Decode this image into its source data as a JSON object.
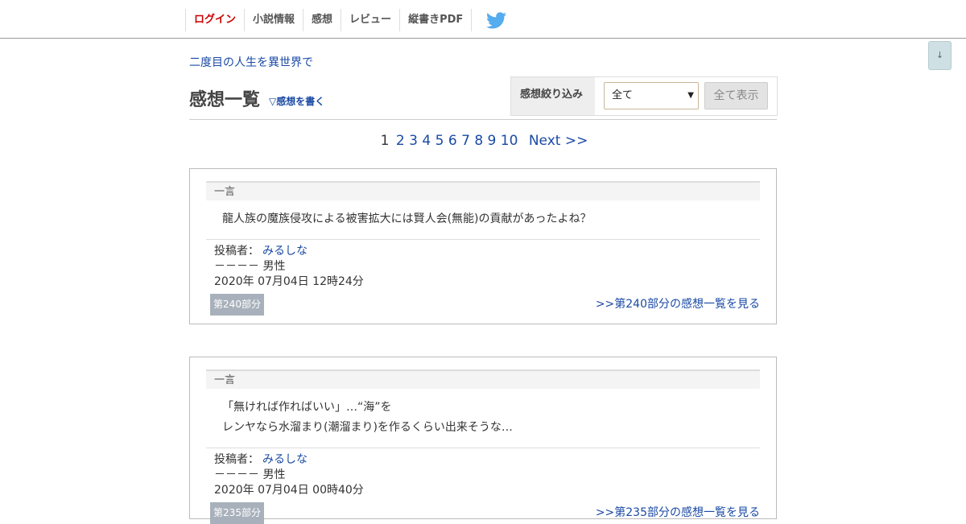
{
  "nav": {
    "items": [
      "ログイン",
      "小説情報",
      "感想",
      "レビュー",
      "縦書きPDF"
    ],
    "twitter_icon": "twitter-bird-icon",
    "accent_color": "#cc0000"
  },
  "scroll_button": "↓",
  "novel_title": "二度目の人生を異世界で",
  "page_title": "感想一覧",
  "write_link": "▽感想を書く",
  "filter": {
    "label": "感想絞り込み",
    "selected": "全て",
    "show_all": "全て表示"
  },
  "pager": {
    "pages": [
      "1",
      "2",
      "3",
      "4",
      "5",
      "6",
      "7",
      "8",
      "9",
      "10"
    ],
    "current": "1",
    "next": "Next >>"
  },
  "impressions": [
    {
      "header": "一言",
      "lines": [
        "龍人族の魔族侵攻による被害拡大には賢人会(無能)の貢献があったよね？"
      ],
      "poster_label": "投稿者：",
      "poster_name": "みるしな",
      "age_gender": "－－－－ 男性",
      "date": "2020年 07月04日 12時24分",
      "part": "第240部分",
      "part_link": ">>第240部分の感想一覧を見る"
    },
    {
      "header": "一言",
      "lines": [
        "「無ければ作ればいい」…“海”を",
        "レンヤなら水溜まり(潮溜まり)を作るくらい出来そうな…"
      ],
      "poster_label": "投稿者：",
      "poster_name": "みるしな",
      "age_gender": "－－－－ 男性",
      "date": "2020年 07月04日 00時40分",
      "part": "第235部分",
      "part_link": ">>第235部分の感想一覧を見る"
    }
  ]
}
